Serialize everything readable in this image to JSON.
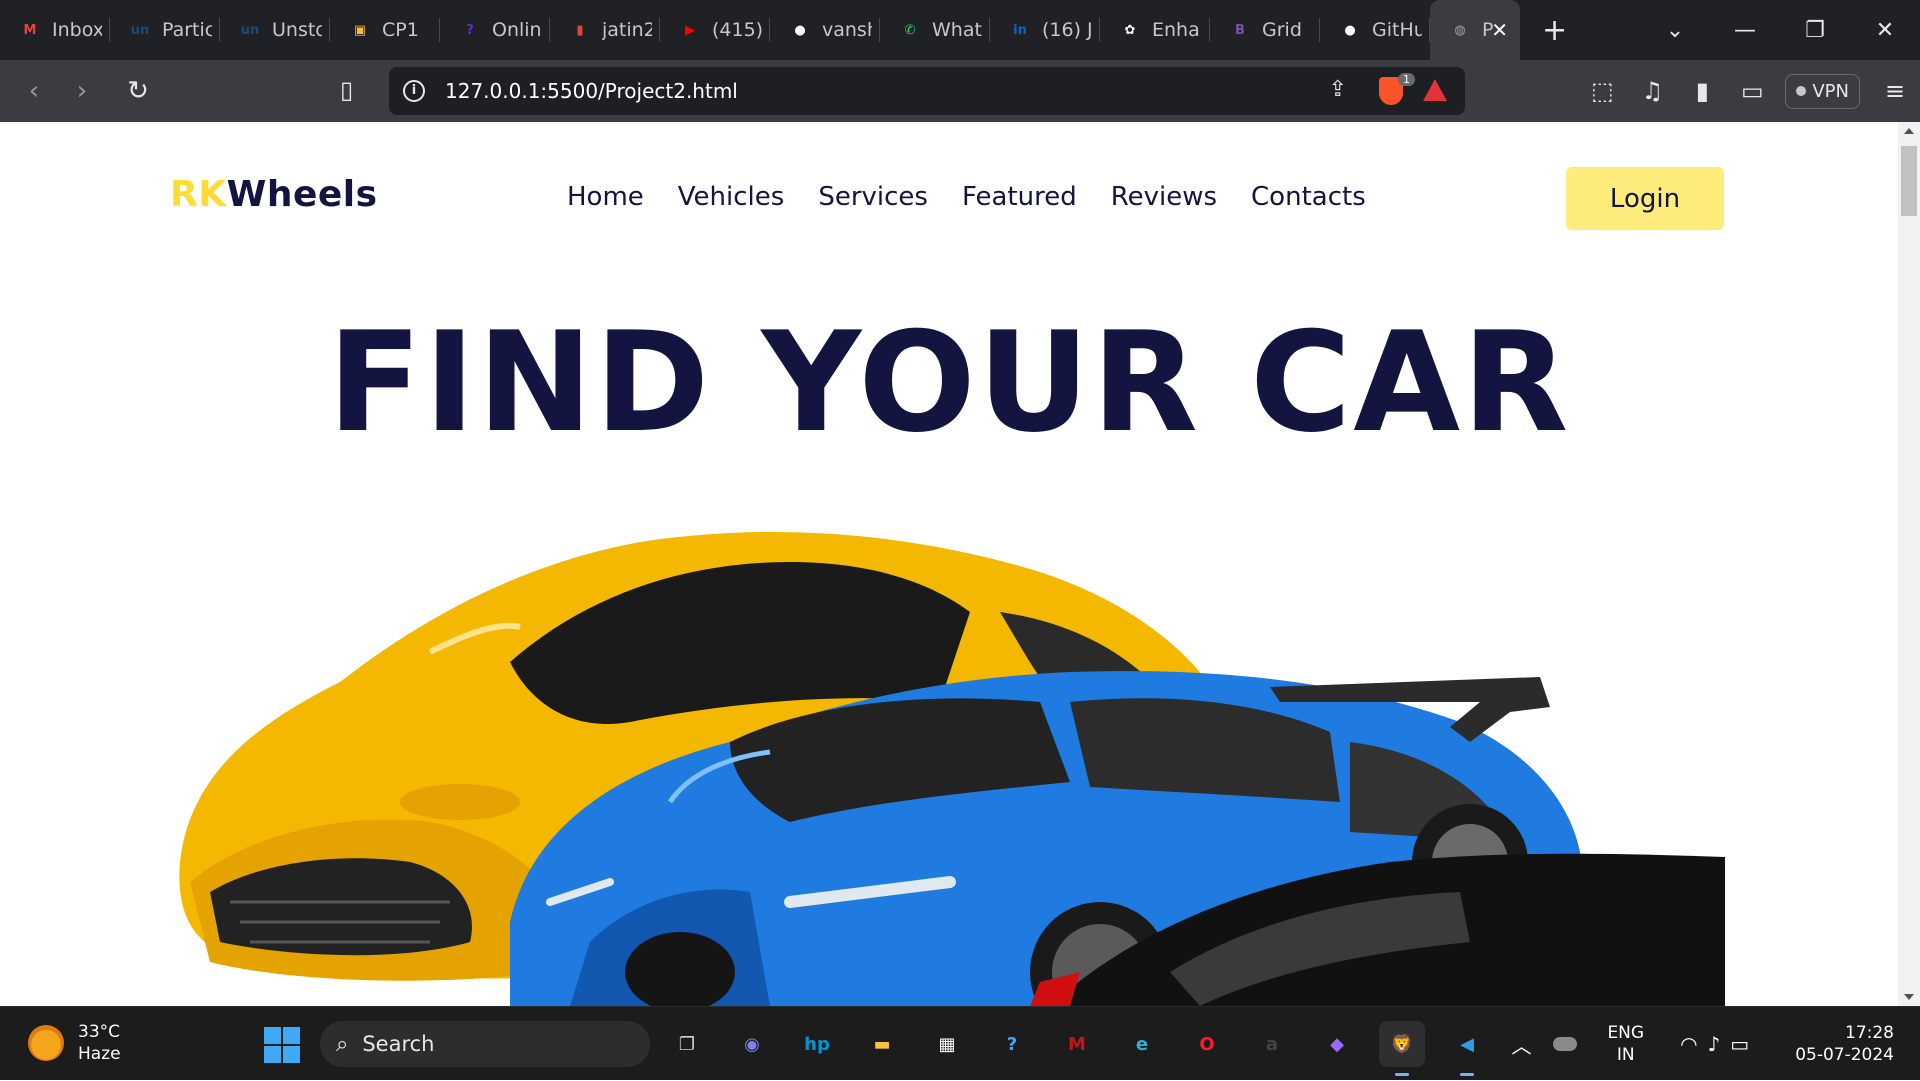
{
  "browser": {
    "tabs": [
      {
        "label": "Inbox",
        "icon": "gmail-icon",
        "color": "#ea4335",
        "glyph": "M"
      },
      {
        "label": "Partic",
        "icon": "unstop-icon",
        "color": "#1c4980",
        "glyph": "un"
      },
      {
        "label": "Unsto",
        "icon": "unstop-icon",
        "color": "#1c4980",
        "glyph": "un"
      },
      {
        "label": "CP1",
        "icon": "classroom-icon",
        "color": "#f9bb2d",
        "glyph": "▣"
      },
      {
        "label": "Onlin",
        "icon": "program-icon",
        "color": "#5b2ddb",
        "glyph": "?"
      },
      {
        "label": "jatin2",
        "icon": "chart-icon",
        "color": "#e2463b",
        "glyph": "▮"
      },
      {
        "label": "(415)",
        "icon": "youtube-icon",
        "color": "#ff0000",
        "glyph": "▶"
      },
      {
        "label": "vansh",
        "icon": "github-icon",
        "color": "#ffffff",
        "glyph": "●"
      },
      {
        "label": "What",
        "icon": "whatsapp-icon",
        "color": "#25d366",
        "glyph": "✆"
      },
      {
        "label": "(16) J",
        "icon": "linkedin-icon",
        "color": "#0a66c2",
        "glyph": "in"
      },
      {
        "label": "Enha",
        "icon": "chatgpt-icon",
        "color": "#ffffff",
        "glyph": "✿"
      },
      {
        "label": "Grid",
        "icon": "bootstrap-icon",
        "color": "#7952b3",
        "glyph": "B"
      },
      {
        "label": "GitHu",
        "icon": "github-icon",
        "color": "#ffffff",
        "glyph": "●"
      },
      {
        "label": "P",
        "icon": "globe-icon",
        "color": "#9aa0a6",
        "glyph": "◍"
      }
    ],
    "new_tab": "+",
    "url": "127.0.0.1:5500/Project2.html",
    "brave_badge": "1",
    "vpn_label": "VPN"
  },
  "site": {
    "logo_prefix": "RK",
    "logo_main": "Wheels",
    "nav": [
      "Home",
      "Vehicles",
      "Services",
      "Featured",
      "Reviews",
      "Contacts"
    ],
    "login_label": "Login",
    "hero_title": "FIND YOUR CAR",
    "colors": {
      "accent": "#fddc36",
      "navy": "#141440",
      "button": "#fdeb7b"
    }
  },
  "taskbar": {
    "weather_temp": "33°C",
    "weather_desc": "Haze",
    "search_label": "Search",
    "apps": [
      {
        "name": "task-view-icon",
        "glyph": "❐",
        "color": "#d0d0d0"
      },
      {
        "name": "teams-chat-icon",
        "glyph": "◉",
        "color": "#7b83eb"
      },
      {
        "name": "myhp-icon",
        "glyph": "hp",
        "color": "#0096d6"
      },
      {
        "name": "file-explorer-icon",
        "glyph": "▬",
        "color": "#f8c33c"
      },
      {
        "name": "store-icon",
        "glyph": "▦",
        "color": "#ffffff"
      },
      {
        "name": "help-icon",
        "glyph": "?",
        "color": "#3fa9f5"
      },
      {
        "name": "mcafee-icon",
        "glyph": "M",
        "color": "#c01818"
      },
      {
        "name": "edge-icon",
        "glyph": "e",
        "color": "#2bb0e0"
      },
      {
        "name": "opera-icon",
        "glyph": "O",
        "color": "#ff1b2d"
      },
      {
        "name": "amazon-icon",
        "glyph": "a",
        "color": "#444444"
      },
      {
        "name": "copilot-icon",
        "glyph": "◆",
        "color": "#9b6bff"
      },
      {
        "name": "brave-icon",
        "glyph": "🦁",
        "color": "#fb542b"
      },
      {
        "name": "vscode-icon",
        "glyph": "◀",
        "color": "#2f9ee8"
      }
    ],
    "lang_top": "ENG",
    "lang_bottom": "IN",
    "time": "17:28",
    "date": "05-07-2024"
  }
}
